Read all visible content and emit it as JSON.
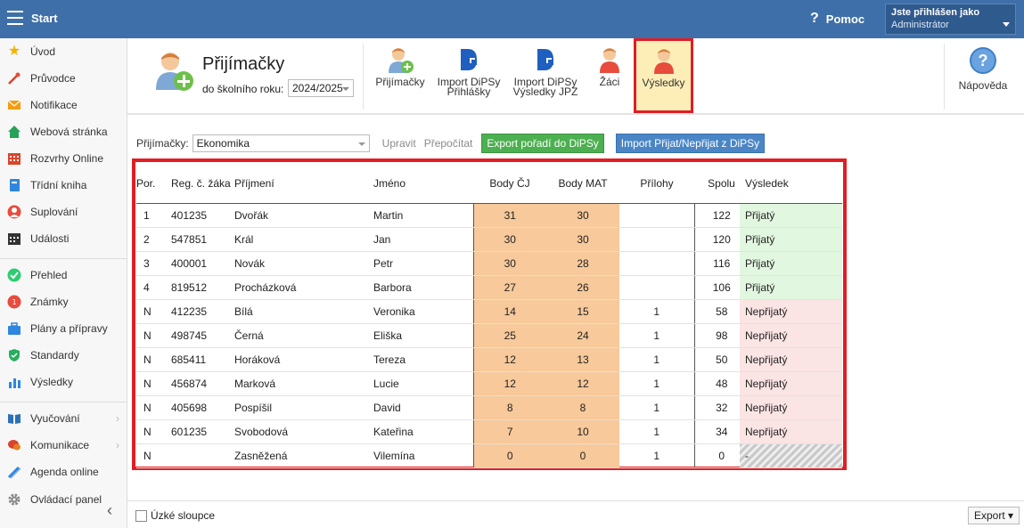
{
  "topbar": {
    "start_label": "Start",
    "help_label": "Pomoc",
    "user_line1": "Jste přihlášen jako",
    "user_line2": "Administrátor"
  },
  "sidebar": {
    "items": [
      {
        "label": "Úvod",
        "icon": "star-icon"
      },
      {
        "label": "Průvodce",
        "icon": "wand-icon"
      },
      {
        "label": "Notifikace",
        "icon": "envelope-icon"
      },
      {
        "label": "Webová stránka",
        "icon": "home-icon"
      },
      {
        "label": "Rozvrhy Online",
        "icon": "calendar-grid-icon"
      },
      {
        "label": "Třídní kniha",
        "icon": "book-icon"
      },
      {
        "label": "Suplování",
        "icon": "person-icon"
      },
      {
        "label": "Události",
        "icon": "calendar-icon"
      },
      {
        "label": "Přehled",
        "icon": "check-circle-icon"
      },
      {
        "label": "Známky",
        "icon": "grades-icon"
      },
      {
        "label": "Plány a přípravy",
        "icon": "briefcase-icon"
      },
      {
        "label": "Standardy",
        "icon": "shield-icon"
      },
      {
        "label": "Výsledky",
        "icon": "bar-chart-icon"
      },
      {
        "label": "Vyučování",
        "icon": "book-open-icon"
      },
      {
        "label": "Komunikace",
        "icon": "chat-icon"
      },
      {
        "label": "Agenda online",
        "icon": "pencil-icon"
      },
      {
        "label": "Ovládací panel",
        "icon": "gear-icon"
      }
    ]
  },
  "ribbon": {
    "title": "Přijímačky",
    "year_label": "do školního roku:",
    "year_value": "2024/2025",
    "buttons": [
      {
        "line1": "Přijímačky",
        "line2": ""
      },
      {
        "line1": "Import DiPSy",
        "line2": "Přihlášky"
      },
      {
        "line1": "Import DiPSy",
        "line2": "Výsledky JPZ"
      },
      {
        "line1": "Žáci",
        "line2": ""
      },
      {
        "line1": "Výsledky",
        "line2": ""
      }
    ],
    "help_label": "Nápověda"
  },
  "filter": {
    "label": "Přijímačky:",
    "value": "Ekonomika",
    "edit_label": "Upravit",
    "recalc_label": "Přepočítat",
    "export_btn": "Export pořadí do DiPSy",
    "import_btn": "Import Přijat/Nepřijat z DiPSy"
  },
  "table": {
    "headers": {
      "por": "Por.",
      "reg": "Reg. č. žáka",
      "prijmeni": "Příjmení",
      "jmeno": "Jméno",
      "body_cj": "Body ČJ",
      "body_mat": "Body MAT",
      "prilohy": "Přílohy",
      "spolu": "Spolu",
      "vysledek": "Výsledek"
    },
    "rows": [
      {
        "por": "1",
        "reg": "401235",
        "prijmeni": "Dvořák",
        "jmeno": "Martin",
        "cj": "31",
        "mat": "30",
        "pril": "",
        "spolu": "122",
        "vys": "Přijatý",
        "status": "ok"
      },
      {
        "por": "2",
        "reg": "547851",
        "prijmeni": "Král",
        "jmeno": "Jan",
        "cj": "30",
        "mat": "30",
        "pril": "",
        "spolu": "120",
        "vys": "Přijatý",
        "status": "ok"
      },
      {
        "por": "3",
        "reg": "400001",
        "prijmeni": "Novák",
        "jmeno": "Petr",
        "cj": "30",
        "mat": "28",
        "pril": "",
        "spolu": "116",
        "vys": "Přijatý",
        "status": "ok"
      },
      {
        "por": "4",
        "reg": "819512",
        "prijmeni": "Procházková",
        "jmeno": "Barbora",
        "cj": "27",
        "mat": "26",
        "pril": "",
        "spolu": "106",
        "vys": "Přijatý",
        "status": "ok"
      },
      {
        "por": "N",
        "reg": "412235",
        "prijmeni": "Bílá",
        "jmeno": "Veronika",
        "cj": "14",
        "mat": "15",
        "pril": "1",
        "spolu": "58",
        "vys": "Nepřijatý",
        "status": "bad"
      },
      {
        "por": "N",
        "reg": "498745",
        "prijmeni": "Černá",
        "jmeno": "Eliška",
        "cj": "25",
        "mat": "24",
        "pril": "1",
        "spolu": "98",
        "vys": "Nepřijatý",
        "status": "bad"
      },
      {
        "por": "N",
        "reg": "685411",
        "prijmeni": "Horáková",
        "jmeno": "Tereza",
        "cj": "12",
        "mat": "13",
        "pril": "1",
        "spolu": "50",
        "vys": "Nepřijatý",
        "status": "bad"
      },
      {
        "por": "N",
        "reg": "456874",
        "prijmeni": "Marková",
        "jmeno": "Lucie",
        "cj": "12",
        "mat": "12",
        "pril": "1",
        "spolu": "48",
        "vys": "Nepřijatý",
        "status": "bad"
      },
      {
        "por": "N",
        "reg": "405698",
        "prijmeni": "Pospíšil",
        "jmeno": "David",
        "cj": "8",
        "mat": "8",
        "pril": "1",
        "spolu": "32",
        "vys": "Nepřijatý",
        "status": "bad"
      },
      {
        "por": "N",
        "reg": "601235",
        "prijmeni": "Svobodová",
        "jmeno": "Kateřina",
        "cj": "7",
        "mat": "10",
        "pril": "1",
        "spolu": "34",
        "vys": "Nepřijatý",
        "status": "bad"
      },
      {
        "por": "N",
        "reg": "",
        "prijmeni": "Zasněžená",
        "jmeno": "Vilemína",
        "cj": "0",
        "mat": "0",
        "pril": "1",
        "spolu": "0",
        "vys": "-",
        "status": "none"
      }
    ]
  },
  "footer": {
    "narrow_label": "Úzké sloupce",
    "export_label": "Export ▾"
  },
  "colors": {
    "topbar": "#3f6fa8",
    "highlight": "#e01e24",
    "score_bg": "#f8c99a",
    "accepted_bg": "#e2f7df",
    "rejected_bg": "#fbe4e4"
  }
}
